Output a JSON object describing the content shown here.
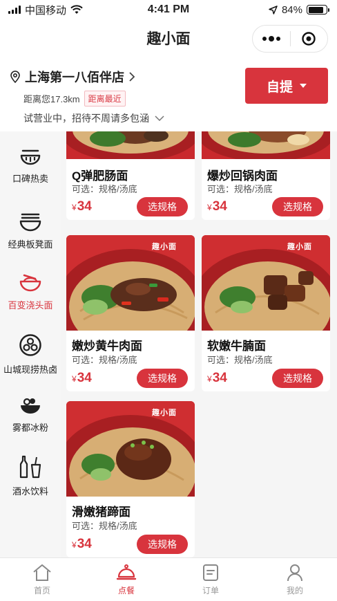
{
  "status_bar": {
    "carrier": "中国移动",
    "time": "4:41 PM",
    "battery": "84%",
    "battery_level": 0.84
  },
  "app": {
    "title": "趣小面"
  },
  "store": {
    "name": "上海第一八佰伴店",
    "distance": "距离您17.3km",
    "badge": "距离最近",
    "notice": "试营业中，招待不周请多包涵",
    "pickup_label": "自提"
  },
  "categories": [
    {
      "label": "口碑热卖",
      "icon": "bowl-icon",
      "active": false
    },
    {
      "label": "经典板凳面",
      "icon": "noodle-bowl-icon",
      "active": false
    },
    {
      "label": "百变浇头面",
      "icon": "bowl-toppings-icon",
      "active": true
    },
    {
      "label": "山城现捞热卤",
      "icon": "braised-icon",
      "active": false
    },
    {
      "label": "雾都冰粉",
      "icon": "ice-jelly-icon",
      "active": false
    },
    {
      "label": "酒水饮料",
      "icon": "drinks-icon",
      "active": false
    }
  ],
  "products": [
    {
      "name": "Q弹肥肠面",
      "options": "可选：规格/汤底",
      "currency": "¥",
      "price": "34",
      "button": "选规格"
    },
    {
      "name": "爆炒回锅肉面",
      "options": "可选：规格/汤底",
      "currency": "¥",
      "price": "34",
      "button": "选规格"
    },
    {
      "name": "嫩炒黄牛肉面",
      "options": "可选：规格/汤底",
      "currency": "¥",
      "price": "34",
      "button": "选规格",
      "logo": "趣小面"
    },
    {
      "name": "软嫩牛腩面",
      "options": "可选：规格/汤底",
      "currency": "¥",
      "price": "34",
      "button": "选规格",
      "logo": "趣小面"
    },
    {
      "name": "滑嫩猪蹄面",
      "options": "可选：规格/汤底",
      "currency": "¥",
      "price": "34",
      "button": "选规格",
      "logo": "趣小面"
    }
  ],
  "tabs": [
    {
      "label": "首页",
      "icon": "home-icon",
      "active": false
    },
    {
      "label": "点餐",
      "icon": "cloche-icon",
      "active": true
    },
    {
      "label": "订单",
      "icon": "order-icon",
      "active": false
    },
    {
      "label": "我的",
      "icon": "user-icon",
      "active": false
    }
  ],
  "colors": {
    "accent": "#d8343d",
    "badge_bg": "#fff3f4"
  }
}
